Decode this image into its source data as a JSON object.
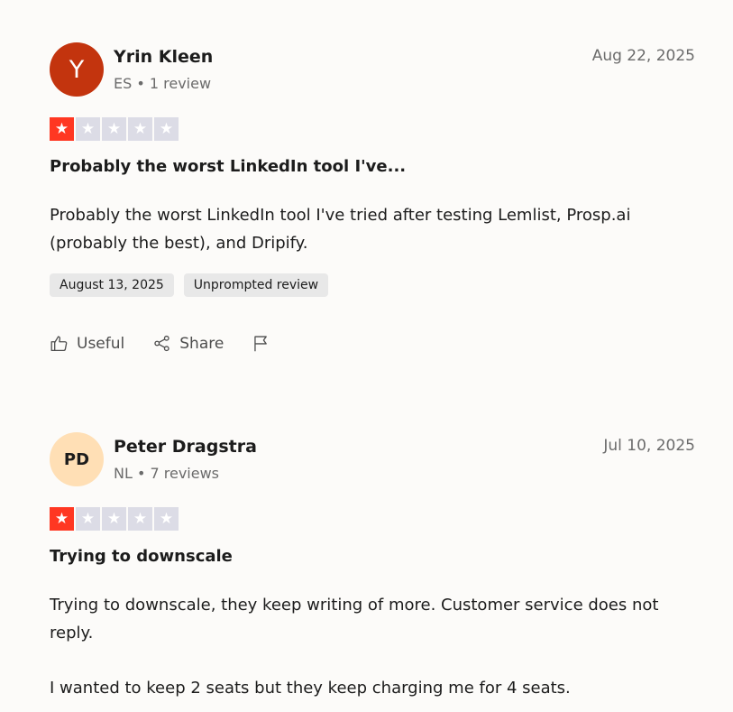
{
  "reviews": [
    {
      "avatar_initials": "Y",
      "avatar_color": "#c3340e",
      "name": "Yrin Kleen",
      "meta": "ES • 1 review",
      "date": "Aug 22, 2025",
      "rating": 1,
      "rating_max": 5,
      "title": "Probably the worst LinkedIn tool I've...",
      "body": [
        "Probably the worst LinkedIn tool I've tried after testing Lemlist, Prosp.ai (probably the best), and Dripify."
      ],
      "experience_date": "August 13, 2025",
      "review_type": "Unprompted review",
      "actions": {
        "useful": "Useful",
        "share": "Share"
      }
    },
    {
      "avatar_initials": "PD",
      "avatar_color": "#ffdfb5",
      "name": "Peter Dragstra",
      "meta": "NL • 7 reviews",
      "date": "Jul 10, 2025",
      "rating": 1,
      "rating_max": 5,
      "title": "Trying to downscale",
      "body": [
        "Trying to downscale, they keep writing of more. Customer service does not reply.",
        "I wanted to keep 2 seats but they keep charging me for 4 seats."
      ]
    }
  ],
  "colors": {
    "star_active": "#ff3722",
    "star_inactive": "#dcdce6",
    "page_background": "#fcfbf9"
  },
  "icons": [
    "star-icon",
    "thumbs-up-icon",
    "share-icon",
    "flag-icon"
  ]
}
